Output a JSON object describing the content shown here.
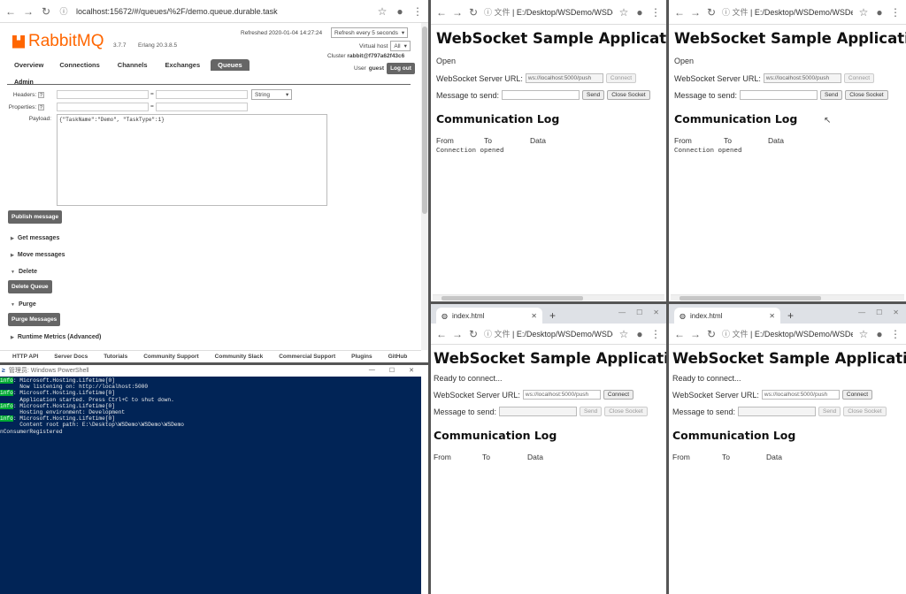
{
  "rabbit": {
    "url": "localhost:15672/#/queues/%2F/demo.queue.durable.task",
    "logo_text": "RabbitMQ",
    "version": "3.7.7",
    "erlang": "Erlang 20.3.8.5",
    "refreshed": "Refreshed 2020-01-04 14:27:24",
    "refresh_select": "Refresh every 5 seconds",
    "virtual_host_label": "Virtual host",
    "virtual_host_value": "All",
    "cluster_label": "Cluster",
    "cluster_value": "rabbit@f797a62f43c6",
    "user_label": "User",
    "user_value": "guest",
    "logout": "Log out",
    "tabs": [
      "Overview",
      "Connections",
      "Channels",
      "Exchanges",
      "Queues"
    ],
    "admin": "Admin",
    "headers_label": "Headers:",
    "properties_label": "Properties:",
    "payload_label": "Payload:",
    "eq": "=",
    "string_select": "String",
    "payload_value": "{\"TaskName\":\"Demo\", \"TaskType\":1}",
    "publish_button": "Publish message",
    "sections": [
      "Get messages",
      "Move messages",
      "Delete",
      "Purge",
      "Runtime Metrics (Advanced)"
    ],
    "delete_button": "Delete Queue",
    "purge_button": "Purge Messages",
    "footer_links": [
      "HTTP API",
      "Server Docs",
      "Tutorials",
      "Community Support",
      "Community Slack",
      "Commercial Support",
      "Plugins",
      "GitHub"
    ],
    "help_glyph": "?"
  },
  "powershell": {
    "title": "管理员: Windows PowerShell",
    "lines": [
      {
        "tag": "info",
        "text": ": Microsoft.Hosting.Lifetime[0]"
      },
      {
        "tag": "",
        "text": "      Now listening on: http://localhost:5000"
      },
      {
        "tag": "info",
        "text": ": Microsoft.Hosting.Lifetime[0]"
      },
      {
        "tag": "",
        "text": "      Application started. Press Ctrl+C to shut down."
      },
      {
        "tag": "info",
        "text": ": Microsoft.Hosting.Lifetime[0]"
      },
      {
        "tag": "",
        "text": "      Hosting environment: Development"
      },
      {
        "tag": "info",
        "text": ": Microsoft.Hosting.Lifetime[0]"
      },
      {
        "tag": "",
        "text": "      Content root path: E:\\Desktop\\WSDemo\\WSDemo\\WSDemo"
      },
      {
        "tag": "",
        "text": "nConsumerRegistered"
      }
    ]
  },
  "ws": {
    "file_label": "文件",
    "url_short": "E:/Desktop/WSDemo/WSDem...",
    "url_short2": "E:/Desktop/WSDemo/WSDemo...",
    "tab_title": "index.html",
    "title": "WebSocket Sample Application",
    "status_open": "Open",
    "status_ready": "Ready to connect...",
    "server_url_label": "WebSocket Server URL:",
    "server_url_value": "ws://localhost:5000/push",
    "connect": "Connect",
    "message_label": "Message to send:",
    "send": "Send",
    "close_socket": "Close Socket",
    "log_title": "Communication Log",
    "col_from": "From",
    "col_to": "To",
    "col_data": "Data",
    "log_entry": "Connection opened"
  }
}
